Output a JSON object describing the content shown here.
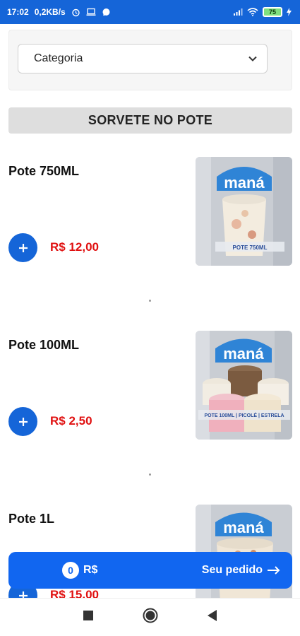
{
  "status_bar": {
    "time": "17:02",
    "speed": "0,2KB/s",
    "battery": "75"
  },
  "filter": {
    "category_select": "Categoria"
  },
  "section": {
    "title": "SORVETE NO POTE"
  },
  "products": [
    {
      "name": "Pote 750ML",
      "price": "R$ 12,00",
      "image_label": "POTE 750ML"
    },
    {
      "name": "Pote 100ML",
      "price": "R$ 2,50",
      "image_label": "POTE 100ML | PICOLÉ | ESTRELA"
    },
    {
      "name": "Pote 1L",
      "price": "R$ 15,00"
    }
  ],
  "image_brand": "maná",
  "order_bar": {
    "count": "0",
    "total": "R$",
    "cta": "Seu pedido"
  },
  "colors": {
    "primary": "#1565d8",
    "price": "#e01010"
  }
}
